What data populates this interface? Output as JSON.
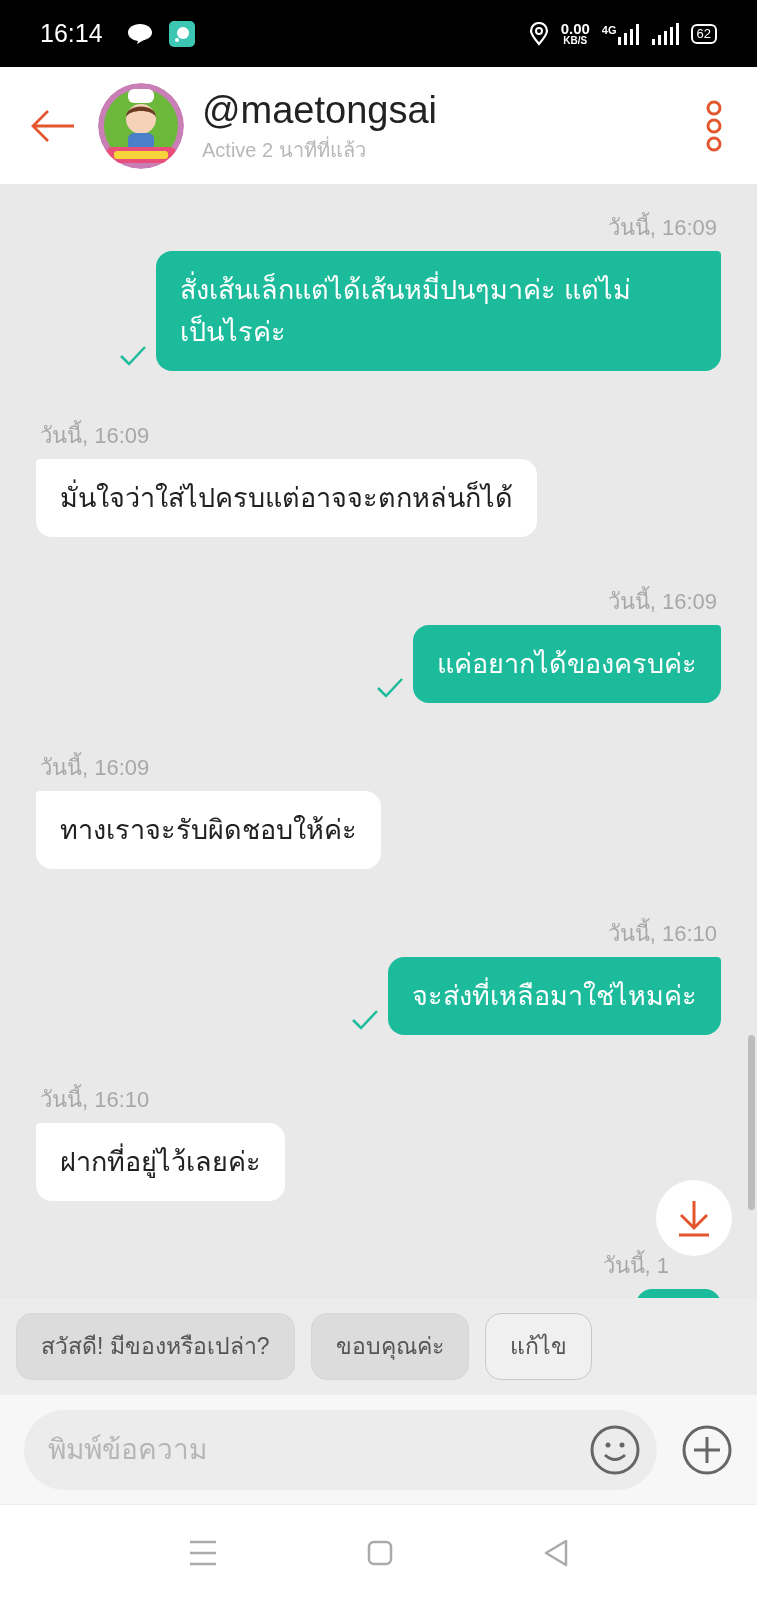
{
  "status_bar": {
    "time": "16:14",
    "speed": "0.00",
    "speed_unit": "KB/S",
    "network": "4G",
    "battery": "62"
  },
  "header": {
    "name": "@maetongsai",
    "status": "Active 2 นาทีที่แล้ว"
  },
  "messages": [
    {
      "kind": "outgoing",
      "time": "วันนี้, 16:09",
      "text": "สั่งเส้นเล็กแต่ได้เส้นหมี่ปนๆมาค่ะ แต่ไม่เป็นไรค่ะ",
      "delivered": true
    },
    {
      "kind": "incoming",
      "time": "วันนี้, 16:09",
      "text": "มั่นใจว่าใส่ไปครบแต่อาจจะตกหล่นก็ได้"
    },
    {
      "kind": "outgoing",
      "time": "วันนี้, 16:09",
      "text": "แค่อยากได้ของครบค่ะ",
      "delivered": true
    },
    {
      "kind": "incoming",
      "time": "วันนี้, 16:09",
      "text": "ทางเราจะรับผิดชอบให้ค่ะ"
    },
    {
      "kind": "outgoing",
      "time": "วันนี้, 16:10",
      "text": "จะส่งที่เหลือมาใช่ไหมค่ะ",
      "delivered": true
    },
    {
      "kind": "incoming",
      "time": "วันนี้, 16:10",
      "text": "ฝากที่อยู่ไว้เลยค่ะ"
    },
    {
      "kind": "outgoing",
      "time": "วันนี้, 1"
    }
  ],
  "quick_replies": [
    {
      "kind": "suggestion",
      "label": "สวัสดี! มีของหรือเปล่า?"
    },
    {
      "kind": "suggestion",
      "label": "ขอบคุณค่ะ"
    },
    {
      "kind": "edit",
      "label": "แก้ไข"
    }
  ],
  "composer": {
    "placeholder": "พิมพ์ข้อความ"
  }
}
